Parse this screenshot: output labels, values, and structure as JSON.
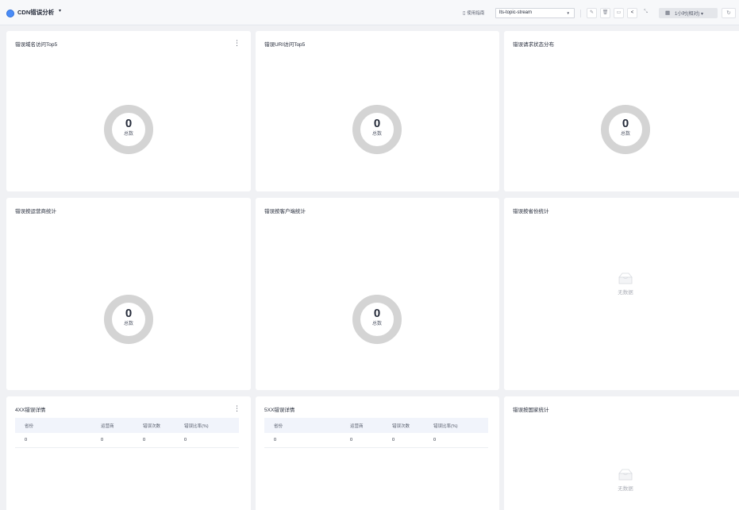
{
  "header": {
    "title": "CDN错误分析",
    "guide_label": "使用指南",
    "stream_value": "lts-topic-stream",
    "time_value": "1小时(相对)"
  },
  "cards": {
    "domain_top5": {
      "title": "错误域名访问Top5",
      "value": "0",
      "label": "总数"
    },
    "uri_top5": {
      "title": "错误URI访问Top5",
      "value": "0",
      "label": "总数"
    },
    "status_dist": {
      "title": "错误请求状态分布",
      "value": "0",
      "label": "总数"
    },
    "isp_stats": {
      "title": "错误按运营商统计",
      "value": "0",
      "label": "总数"
    },
    "client_stats": {
      "title": "错误按客户端统计",
      "value": "0",
      "label": "总数"
    },
    "province_stats": {
      "title": "错误按省份统计",
      "empty_text": "无数据"
    },
    "country_stats": {
      "title": "错误按国家统计",
      "empty_text": "无数据"
    }
  },
  "tables": {
    "err4xx": {
      "title": "4XX错误详情",
      "columns": [
        "省份",
        "运营商",
        "错误次数",
        "错误比率(%)"
      ],
      "rows": [
        [
          "0",
          "0",
          "0",
          "0"
        ]
      ]
    },
    "err5xx": {
      "title": "5XX错误详情",
      "columns": [
        "省份",
        "运营商",
        "错误次数",
        "错误比率(%)"
      ],
      "rows": [
        [
          "0",
          "0",
          "0",
          "0"
        ]
      ]
    }
  },
  "icons": {
    "logo": "cloud-icon",
    "guide": "book-icon",
    "toolbar": [
      "edit-icon",
      "delete-icon",
      "save-icon",
      "share-icon",
      "fullscreen-icon"
    ],
    "time": "calendar-icon",
    "refresh": "refresh-icon"
  },
  "colors": {
    "accent": "#4a8cf7",
    "donut_ring": "#d4d4d4",
    "page_bg": "#f0f1f4"
  }
}
